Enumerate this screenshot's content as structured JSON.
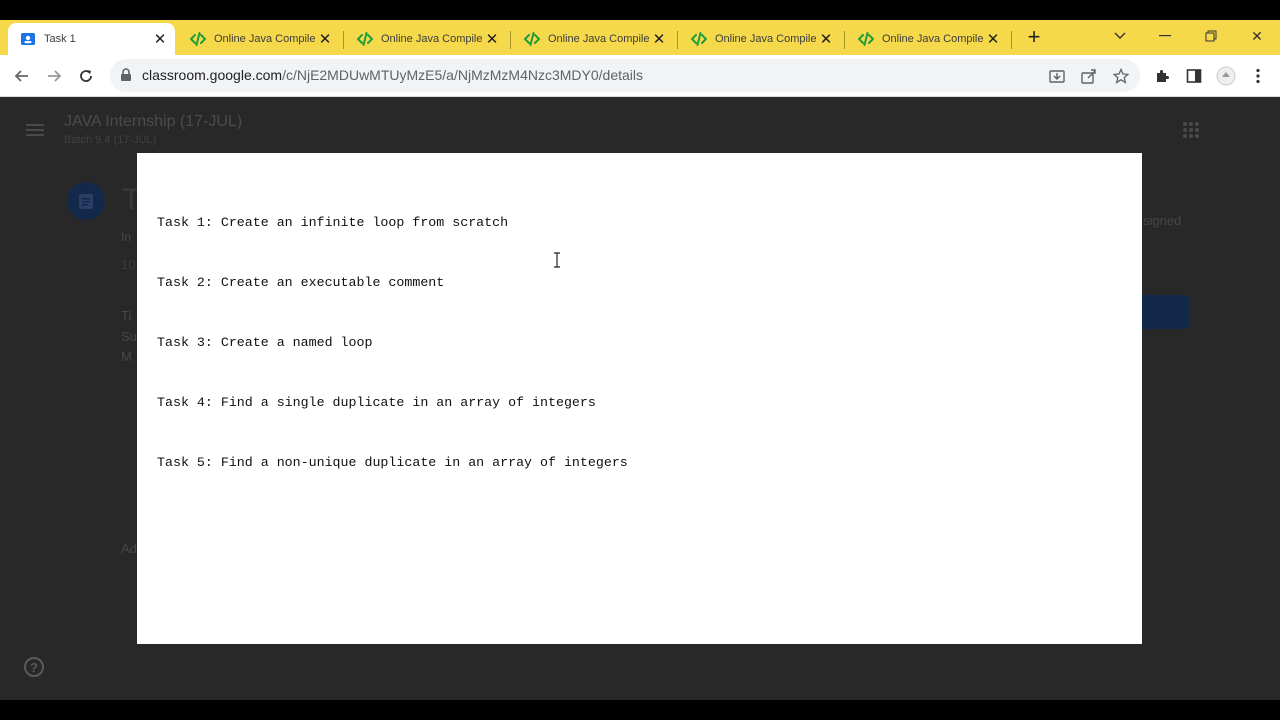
{
  "browser": {
    "tabs": [
      {
        "title": "Task 1",
        "active": true,
        "favicon": "classroom-icon"
      },
      {
        "title": "Online Java Compiler -",
        "active": false,
        "favicon": "code-icon"
      },
      {
        "title": "Online Java Compiler -",
        "active": false,
        "favicon": "code-icon"
      },
      {
        "title": "Online Java Compiler -",
        "active": false,
        "favicon": "code-icon"
      },
      {
        "title": "Online Java Compiler -",
        "active": false,
        "favicon": "code-icon"
      },
      {
        "title": "Online Java Compiler -",
        "active": false,
        "favicon": "code-icon"
      }
    ],
    "url_host": "classroom.google.com",
    "url_path": "/c/NjE2MDUwMTUyMzE5/a/NjMzMzM4Nzc3MDY0/details",
    "tabstrip_color": "#f6d94a"
  },
  "page": {
    "course_title": "JAVA Internship (17-JUL)",
    "course_subtitle": "Batch 9.4 (17-JUL)",
    "bg_fragments": {
      "heading_letter": "T",
      "line_a": "In",
      "line_b": "10",
      "line_c": "Ti",
      "line_d": "Su",
      "line_e": "M",
      "line_f": "Ad",
      "assigned": "signed"
    }
  },
  "document": {
    "lines": [
      "Task 1: Create an infinite loop from scratch",
      "Task 2: Create an executable comment",
      "Task 3: Create a named loop",
      "Task 4: Find a single duplicate in an array of integers",
      "Task 5: Find a non-unique duplicate in an array of integers"
    ]
  }
}
